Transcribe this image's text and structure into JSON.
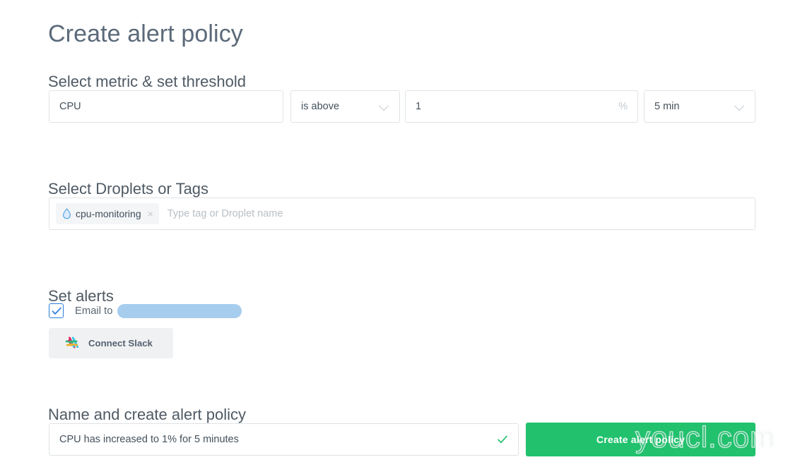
{
  "page": {
    "title": "Create alert policy",
    "watermark": "youcl.com"
  },
  "metric_section": {
    "heading": "Select metric & set threshold",
    "metric": {
      "value": "CPU"
    },
    "operator": {
      "value": "is above",
      "icon": "chevron-down-icon"
    },
    "threshold": {
      "value": "1",
      "suffix": "%"
    },
    "window": {
      "value": "5 min",
      "icon": "chevron-down-icon"
    }
  },
  "droplets_section": {
    "heading": "Select Droplets or Tags",
    "chip": {
      "label": "cpu-monitoring",
      "icon": "droplet-icon",
      "remove_icon": "×"
    },
    "input": {
      "value": "",
      "placeholder": "Type tag or Droplet name"
    }
  },
  "alerts_section": {
    "heading": "Set alerts",
    "email": {
      "checkbox_checked": true,
      "check_icon": "check-icon",
      "label": "Email to",
      "value_redacted": true
    },
    "slack_button": {
      "label": "Connect Slack",
      "icon": "slack-icon"
    }
  },
  "name_section": {
    "heading": "Name and create alert policy",
    "name_input": {
      "value": "CPU has increased to 1% for 5 minutes",
      "valid_icon": "check-icon"
    },
    "submit_button": {
      "label": "Create alert policy"
    }
  },
  "colors": {
    "accent_green": "#21c16d",
    "accent_blue": "#2b7ddb",
    "heading_text": "#4f5a64",
    "title_text": "#5b6a7a",
    "border": "#dfe3e6",
    "chip_bg": "#f4f5f6",
    "redacted_pill": "#a7cdee"
  }
}
